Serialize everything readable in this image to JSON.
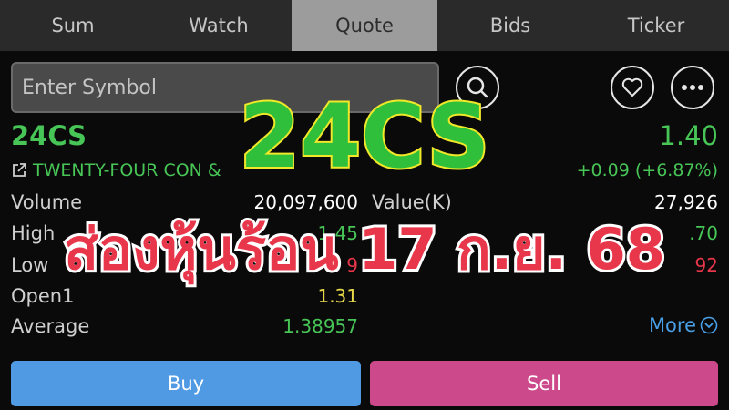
{
  "tabs": [
    "Sum",
    "Watch",
    "Quote",
    "Bids",
    "Ticker"
  ],
  "active_tab": "Quote",
  "search": {
    "placeholder": "Enter Symbol"
  },
  "quote": {
    "symbol": "24CS",
    "company": "TWENTY-FOUR CON &",
    "price": "1.40",
    "change": "+0.09 (+6.87%)"
  },
  "left_rows": [
    {
      "label": "Volume",
      "value": "20,097,600"
    },
    {
      "label": "High",
      "value": "1.45"
    },
    {
      "label": "Low",
      "value": "9"
    },
    {
      "label": "Open1",
      "value": "1.31"
    },
    {
      "label": "Average",
      "value": "1.38957"
    }
  ],
  "right_rows": [
    {
      "label": "Value(K)",
      "value": "27,926"
    },
    {
      "label": "",
      "value": ".70"
    },
    {
      "label": "",
      "value": "92"
    }
  ],
  "more_label": "More",
  "buttons": {
    "buy": "Buy",
    "sell": "Sell"
  },
  "overlay": {
    "symbol": "24CS",
    "headline": "ส่องหุ้นร้อน 17 ก.ย. 68"
  },
  "colors": {
    "up": "#47c556",
    "down": "#e8364a",
    "neutral_yellow": "#e6d84a",
    "link": "#4a9fe6",
    "buy": "#4f9ae3",
    "sell": "#cc4a8c"
  }
}
